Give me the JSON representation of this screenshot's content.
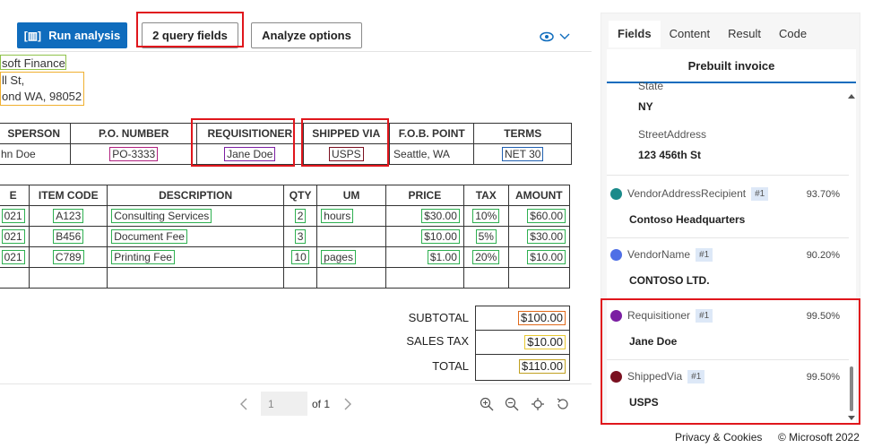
{
  "toolbar": {
    "run_label": "Run analysis",
    "query_label": "2 query fields",
    "analyze_label": "Analyze options"
  },
  "document": {
    "address": [
      "soft Finance",
      "ll St,",
      "ond WA, 98052"
    ],
    "table1": {
      "headers": [
        "SPERSON",
        "P.O. NUMBER",
        "REQUISITIONER",
        "SHIPPED VIA",
        "F.O.B. POINT",
        "TERMS"
      ],
      "row": [
        "hn Doe",
        "PO-3333",
        "Jane Doe",
        "USPS",
        "Seattle, WA",
        "NET 30"
      ]
    },
    "table2": {
      "headers": [
        "E",
        "ITEM CODE",
        "DESCRIPTION",
        "QTY",
        "UM",
        "PRICE",
        "TAX",
        "AMOUNT"
      ],
      "rows": [
        [
          "021",
          "A123",
          "Consulting Services",
          "2",
          "hours",
          "$30.00",
          "10%",
          "$60.00"
        ],
        [
          "021",
          "B456",
          "Document Fee",
          "3",
          "",
          "$10.00",
          "5%",
          "$30.00"
        ],
        [
          "021",
          "C789",
          "Printing Fee",
          "10",
          "pages",
          "$1.00",
          "20%",
          "$10.00"
        ]
      ]
    },
    "totals": [
      {
        "label": "SUBTOTAL",
        "value": "$100.00"
      },
      {
        "label": "SALES TAX",
        "value": "$10.00"
      },
      {
        "label": "TOTAL",
        "value": "$110.00"
      }
    ]
  },
  "pager": {
    "page": "1",
    "of": "of 1"
  },
  "right": {
    "tabs": [
      "Fields",
      "Content",
      "Result",
      "Code"
    ],
    "model": "Prebuilt invoice",
    "fields": [
      {
        "label": "State",
        "value": "NY"
      },
      {
        "label": "StreetAddress",
        "value": "123 456th St"
      },
      {
        "label": "VendorAddressRecipient",
        "badge": "#1",
        "conf": "93.70%",
        "value": "Contoso Headquarters",
        "color": "#1a8a8a"
      },
      {
        "label": "VendorName",
        "badge": "#1",
        "conf": "90.20%",
        "value": "CONTOSO LTD.",
        "color": "#4f6fe6"
      },
      {
        "label": "Requisitioner",
        "badge": "#1",
        "conf": "99.50%",
        "value": "Jane Doe",
        "color": "#7b1fa2"
      },
      {
        "label": "ShippedVia",
        "badge": "#1",
        "conf": "99.50%",
        "value": "USPS",
        "color": "#7a1020"
      }
    ]
  },
  "footer": {
    "privacy": "Privacy & Cookies",
    "copyright": "© Microsoft 2022"
  }
}
